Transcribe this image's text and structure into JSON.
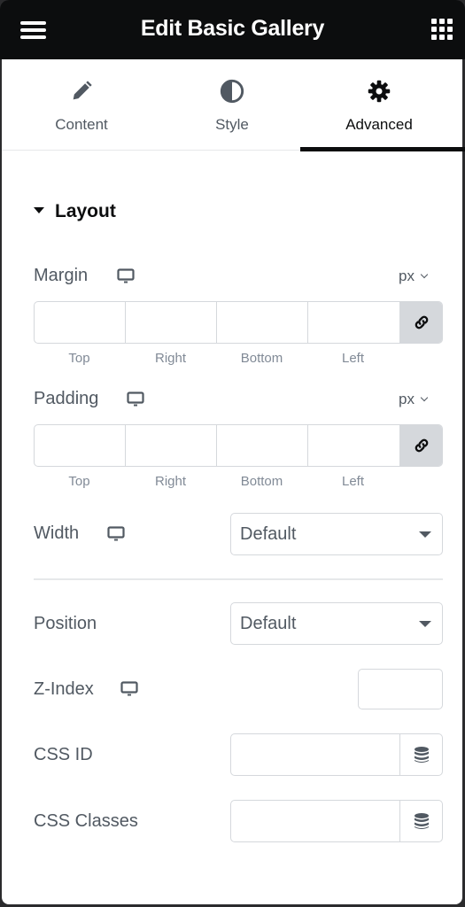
{
  "header": {
    "title": "Edit Basic Gallery",
    "menu_icon": "hamburger-icon",
    "apps_icon": "grid-icon"
  },
  "tabs": [
    {
      "label": "Content",
      "icon": "pencil-icon",
      "active": false
    },
    {
      "label": "Style",
      "icon": "half-circle-icon",
      "active": false
    },
    {
      "label": "Advanced",
      "icon": "gear-icon",
      "active": true
    }
  ],
  "section": {
    "title": "Layout",
    "expanded": true
  },
  "margin": {
    "label": "Margin",
    "unit": "px",
    "device_icon": "desktop-icon",
    "values": {
      "top": "",
      "right": "",
      "bottom": "",
      "left": ""
    },
    "linked": true,
    "sub_labels": [
      "Top",
      "Right",
      "Bottom",
      "Left"
    ]
  },
  "padding": {
    "label": "Padding",
    "unit": "px",
    "device_icon": "desktop-icon",
    "values": {
      "top": "",
      "right": "",
      "bottom": "",
      "left": ""
    },
    "linked": true,
    "sub_labels": [
      "Top",
      "Right",
      "Bottom",
      "Left"
    ]
  },
  "width": {
    "label": "Width",
    "device_icon": "desktop-icon",
    "value": "Default"
  },
  "position": {
    "label": "Position",
    "value": "Default"
  },
  "z_index": {
    "label": "Z-Index",
    "device_icon": "desktop-icon",
    "value": ""
  },
  "css_id": {
    "label": "CSS ID",
    "value": "",
    "dynamic_icon": "database-icon"
  },
  "css_classes": {
    "label": "CSS Classes",
    "value": "",
    "dynamic_icon": "database-icon"
  },
  "colors": {
    "header_bg": "#0c0d0e",
    "text": "#515962",
    "muted": "#818a96",
    "border": "#d5d8dc",
    "active_tab": "#0c0d0e"
  }
}
